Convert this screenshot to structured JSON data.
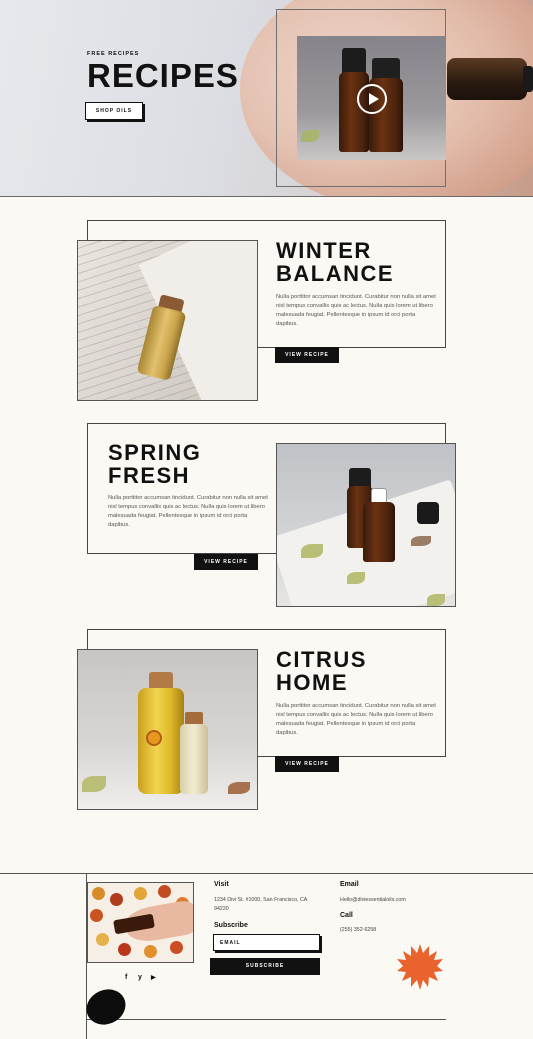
{
  "hero": {
    "eyebrow": "FREE RECIPES",
    "title": "RECIPES",
    "button": "SHOP OILS",
    "video_icon": "play-icon"
  },
  "recipes": [
    {
      "title_line1": "WINTER",
      "title_line2": "BALANCE",
      "description": "Nulla porttitor accumsan tincidunt. Curabitur non nulla sit amet nisl tempus convallis quis ac lectus. Nulla quis lorem ut libero malesuada feugiat. Pellentesque in ipsum id orci porta dapibus.",
      "button": "VIEW RECIPE"
    },
    {
      "title_line1": "SPRING",
      "title_line2": "FRESH",
      "description": "Nulla porttitor accumsan tincidunt. Curabitur non nulla sit amet nisl tempus convallis quis ac lectus. Nulla quis lorem ut libero malesuada feugiat. Pellentesque in ipsum id orci porta dapibus.",
      "button": "VIEW RECIPE"
    },
    {
      "title_line1": "CITRUS",
      "title_line2": "HOME",
      "description": "Nulla porttitor accumsan tincidunt. Curabitur non nulla sit amet nisl tempus convallis quis ac lectus. Nulla quis lorem ut libero malesuada feugiat. Pellentesque in ipsum id orci porta dapibus.",
      "button": "VIEW RECIPE"
    }
  ],
  "footer": {
    "visit_heading": "Visit",
    "address_line1": "1234 Divi St. #1000, San Francisco, CA",
    "address_line2": "94220",
    "email_heading": "Email",
    "email": "Hello@diviessentialoils.com",
    "call_heading": "Call",
    "phone": "(255) 352-6258",
    "subscribe_heading": "Subscribe",
    "email_placeholder": "EMAIL",
    "subscribe_button": "SUBSCRIBE",
    "social": [
      "f",
      "y",
      "▶"
    ],
    "social_icons": [
      "facebook-icon",
      "twitter-icon",
      "youtube-icon"
    ]
  },
  "colors": {
    "background": "#fbf9f4",
    "text": "#111111",
    "accent": "#e8632e"
  }
}
